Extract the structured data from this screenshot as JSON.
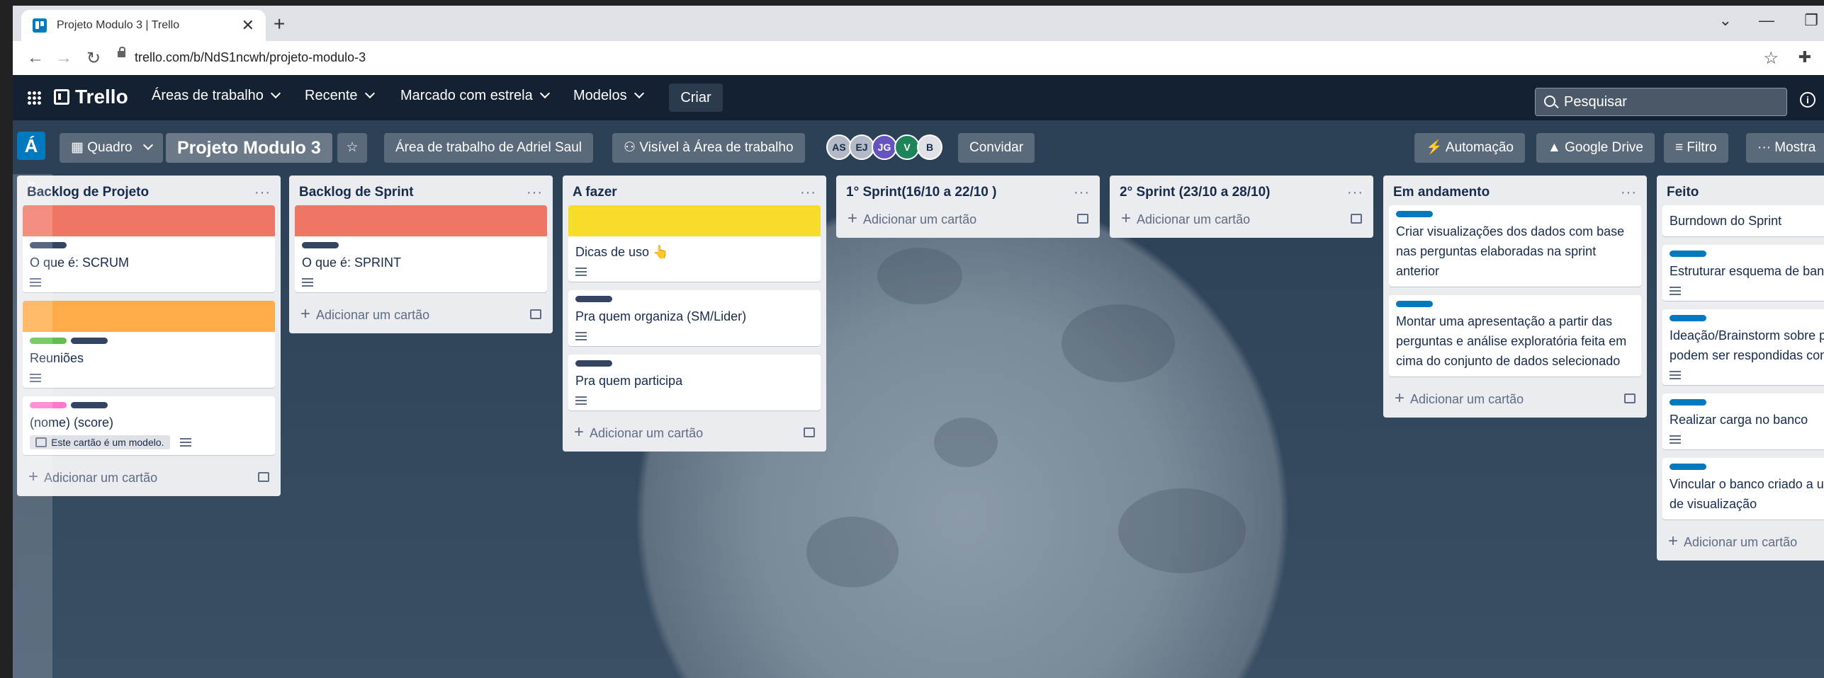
{
  "browser": {
    "tab_title": "Projeto Modulo 3 | Trello",
    "tab_close": "✕",
    "new_tab": "+",
    "url": "trello.com/b/NdS1ncwh/projeto-modulo-3"
  },
  "header": {
    "logo": "Trello",
    "nav": [
      "Áreas de trabalho",
      "Recente",
      "Marcado com estrela",
      "Modelos"
    ],
    "create": "Criar",
    "search_placeholder": "Pesquisar",
    "info": "i"
  },
  "boardbar": {
    "workspace_badge": "Á",
    "view": "Quadro",
    "title": "Projeto Modulo 3",
    "workspace": "Área de trabalho de Adriel Saul",
    "visibility": "Visível à Área de trabalho",
    "members": [
      {
        "initials": "AS",
        "color": "#b3bac5"
      },
      {
        "initials": "EJ",
        "color": "#b3bac5"
      },
      {
        "initials": "JG",
        "color": "#6554c0"
      },
      {
        "initials": "V",
        "color": "#1f845a"
      },
      {
        "initials": "B",
        "color": "#dfe1e6"
      }
    ],
    "invite": "Convidar",
    "automation": "Automação",
    "drive": "Google Drive",
    "filter": "Filtro",
    "show_menu": "Mostra"
  },
  "add_card_label": "Adicionar um cartão",
  "template_note": "Este cartão é um modelo.",
  "lists": [
    {
      "title": "Backlog de Projeto",
      "cards": [
        {
          "cover": "#ef7564",
          "labels": [
            "#344563"
          ],
          "text": "O que é: SCRUM",
          "desc": true
        },
        {
          "cover": "#ffab4a",
          "labels": [
            "#61bd4f",
            "#344563"
          ],
          "text": "Reuniões",
          "desc": true
        },
        {
          "cover": "",
          "labels": [
            "#ff78cb",
            "#344563"
          ],
          "text": "(nome) (score)",
          "template": true
        }
      ]
    },
    {
      "title": "Backlog de Sprint",
      "cards": [
        {
          "cover": "#ef7564",
          "labels": [
            "#344563"
          ],
          "text": "O que é: SPRINT",
          "desc": true
        }
      ]
    },
    {
      "title": "A fazer",
      "cards": [
        {
          "cover": "#f5dd29",
          "labels": [],
          "text": "Dicas de uso 👆",
          "desc": true
        },
        {
          "cover": "",
          "labels": [
            "#344563"
          ],
          "text": "Pra quem organiza (SM/Lider)",
          "desc": true
        },
        {
          "cover": "",
          "labels": [
            "#344563"
          ],
          "text": "Pra quem participa",
          "desc": true
        }
      ]
    },
    {
      "title": "1° Sprint(16/10 a 22/10 )",
      "cards": []
    },
    {
      "title": "2° Sprint (23/10 a 28/10)",
      "cards": []
    },
    {
      "title": "Em andamento",
      "cards": [
        {
          "cover": "",
          "labels": [
            "#0079bf"
          ],
          "text": "Criar visualizações dos dados com base nas perguntas elaboradas na sprint anterior",
          "desc": false
        },
        {
          "cover": "",
          "labels": [
            "#0079bf"
          ],
          "text": "Montar uma apresentação a partir das perguntas e análise exploratória feita em cima do conjunto de dados selecionado",
          "desc": false
        }
      ]
    },
    {
      "title": "Feito",
      "cards": [
        {
          "cover": "",
          "labels": [],
          "text": "Burndown do Sprint",
          "desc": false
        },
        {
          "cover": "",
          "labels": [
            "#0079bf"
          ],
          "text": "Estruturar esquema de banco de dados",
          "desc": true
        },
        {
          "cover": "",
          "labels": [
            "#0079bf"
          ],
          "text": "Ideação/Brainstorm sobre perguntas que podem ser respondidas com os dados",
          "desc": true
        },
        {
          "cover": "",
          "labels": [
            "#0079bf"
          ],
          "text": "Realizar carga no banco",
          "desc": true
        },
        {
          "cover": "",
          "labels": [
            "#0079bf"
          ],
          "text": "Vincular o banco criado a uma ferramenta de visualização",
          "desc": false
        }
      ]
    }
  ]
}
